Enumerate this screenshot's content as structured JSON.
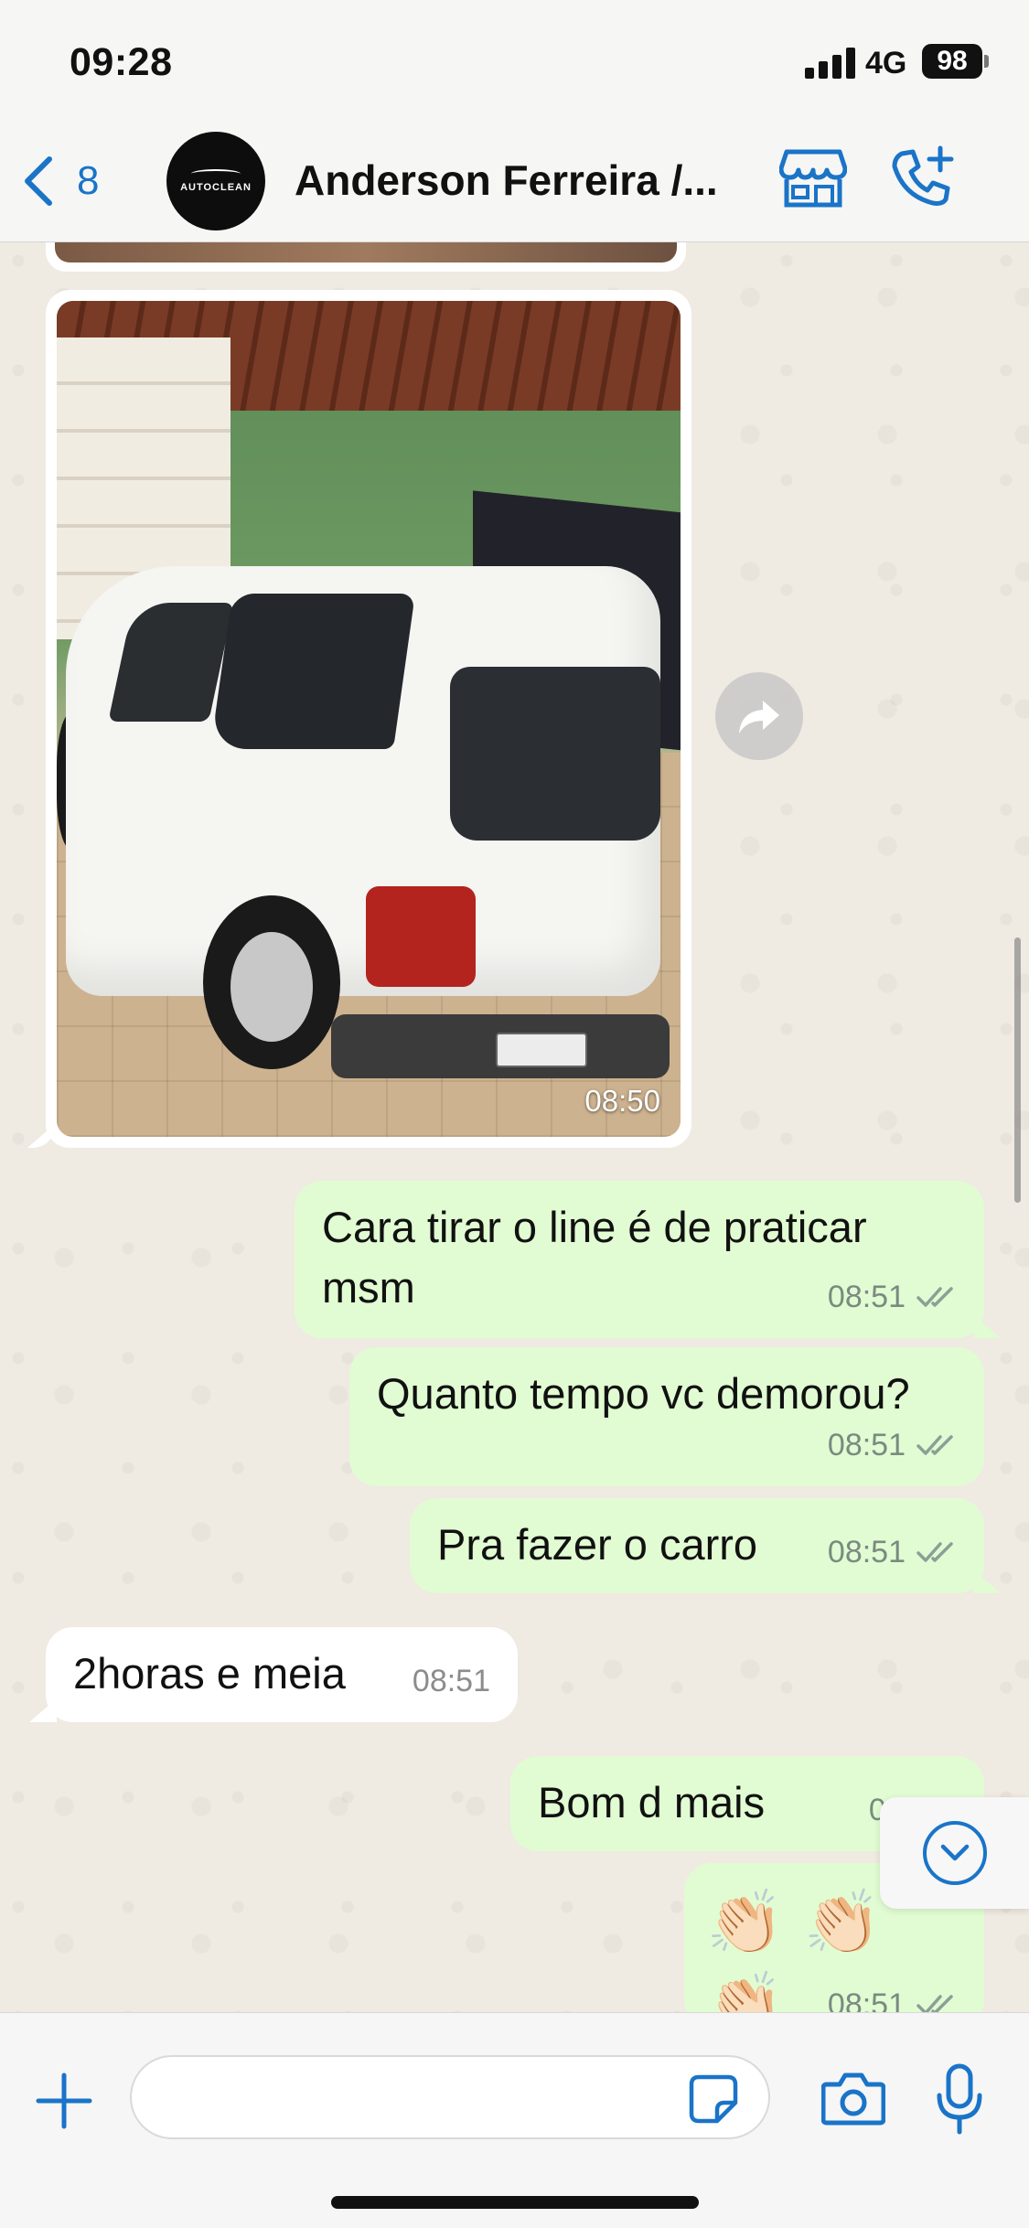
{
  "status_bar": {
    "time": "09:28",
    "network": "4G",
    "battery": "98"
  },
  "header": {
    "back_count": "8",
    "avatar_text": "AUTOCLEAN",
    "contact_name": "Anderson Ferreira /..."
  },
  "messages": [
    {
      "type": "image",
      "direction": "in",
      "time": "08:50"
    },
    {
      "type": "text",
      "direction": "out",
      "text": "Cara tirar o line é de praticar msm",
      "time": "08:51",
      "status": "read"
    },
    {
      "type": "text",
      "direction": "out",
      "text": "Quanto tempo vc demorou?",
      "time": "08:51",
      "status": "read"
    },
    {
      "type": "text",
      "direction": "out",
      "text": "Pra fazer o carro",
      "time": "08:51",
      "status": "read"
    },
    {
      "type": "text",
      "direction": "in",
      "text": "2horas e meia",
      "time": "08:51"
    },
    {
      "type": "text",
      "direction": "out",
      "text": "Bom d mais",
      "time": "08:5",
      "status": "read"
    },
    {
      "type": "emoji",
      "direction": "out",
      "text": "👏🏻👏🏻👏🏻",
      "time": "08:51",
      "status": "read"
    }
  ],
  "composer": {
    "placeholder": "",
    "value": ""
  },
  "icons": [
    "back-chevron-icon",
    "store-icon",
    "add-call-icon",
    "forward-icon",
    "chevron-down-icon",
    "plus-icon",
    "sticker-icon",
    "camera-icon",
    "microphone-icon",
    "double-check-icon"
  ],
  "colors": {
    "accent": "#1a74c8",
    "outgoing_bubble": "#e1fcd2",
    "incoming_bubble": "#ffffff",
    "chat_background": "#efeae2"
  }
}
